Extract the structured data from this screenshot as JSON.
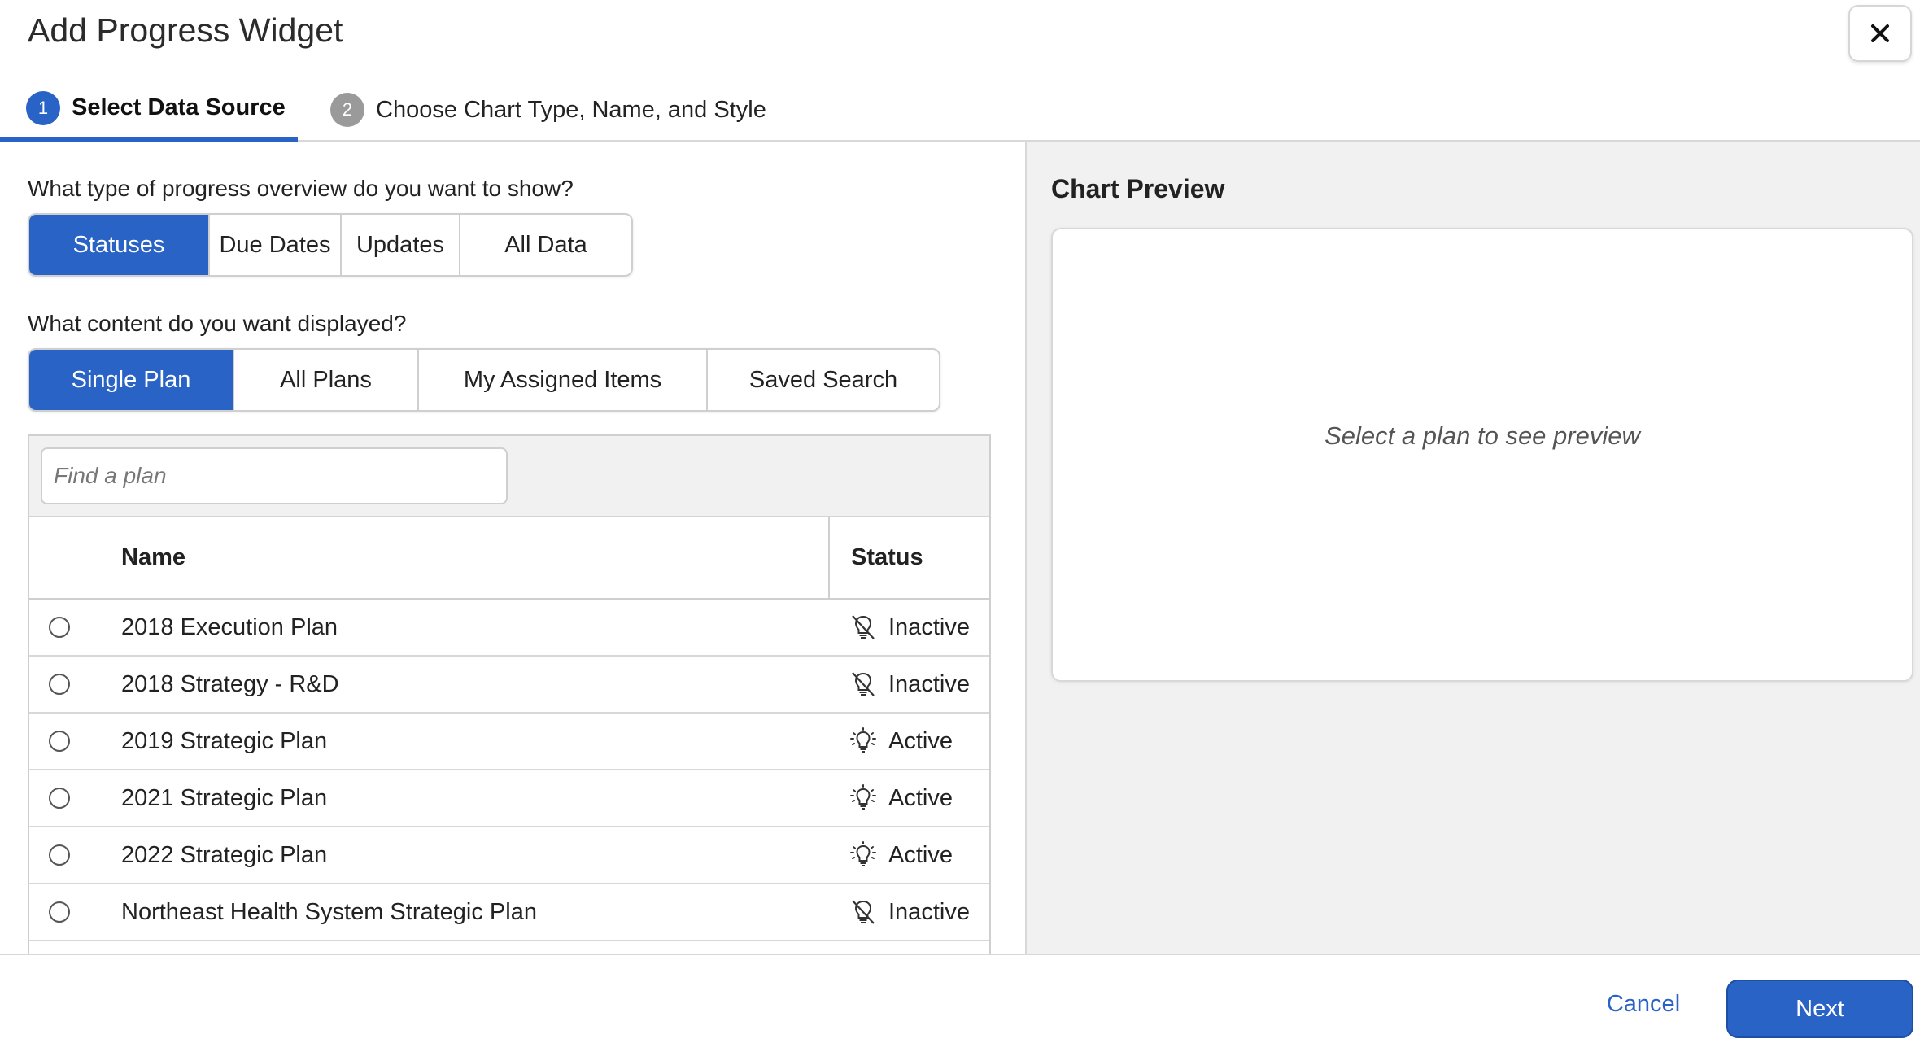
{
  "dialog": {
    "title": "Add Progress Widget",
    "close_icon": "close-icon"
  },
  "steps": [
    {
      "number": "1",
      "label": "Select Data Source",
      "active": true
    },
    {
      "number": "2",
      "label": "Choose Chart Type, Name, and Style",
      "active": false
    }
  ],
  "overview": {
    "question": "What type of progress overview do you want to show?",
    "options": [
      "Statuses",
      "Due Dates",
      "Updates",
      "All Data"
    ],
    "selected": "Statuses"
  },
  "content": {
    "question": "What content do you want displayed?",
    "options": [
      "Single Plan",
      "All Plans",
      "My Assigned Items",
      "Saved Search"
    ],
    "selected": "Single Plan"
  },
  "plan_search": {
    "placeholder": "Find a plan",
    "value": ""
  },
  "plan_table": {
    "columns": [
      "Name",
      "Status"
    ],
    "rows": [
      {
        "name": "2018 Execution Plan",
        "status": "Inactive",
        "icon": "lightbulb-off-icon"
      },
      {
        "name": "2018 Strategy - R&D",
        "status": "Inactive",
        "icon": "lightbulb-off-icon"
      },
      {
        "name": "2019 Strategic Plan",
        "status": "Active",
        "icon": "lightbulb-on-icon"
      },
      {
        "name": "2021 Strategic Plan",
        "status": "Active",
        "icon": "lightbulb-on-icon"
      },
      {
        "name": "2022 Strategic Plan",
        "status": "Active",
        "icon": "lightbulb-on-icon"
      },
      {
        "name": "Northeast Health System Strategic Plan",
        "status": "Inactive",
        "icon": "lightbulb-off-icon"
      }
    ]
  },
  "preview": {
    "title": "Chart Preview",
    "empty_message": "Select a plan to see preview"
  },
  "footer": {
    "cancel_label": "Cancel",
    "next_label": "Next"
  },
  "colors": {
    "accent": "#2a63c6",
    "panel_bg": "#f1f1f1",
    "border": "#cfcfcf"
  }
}
